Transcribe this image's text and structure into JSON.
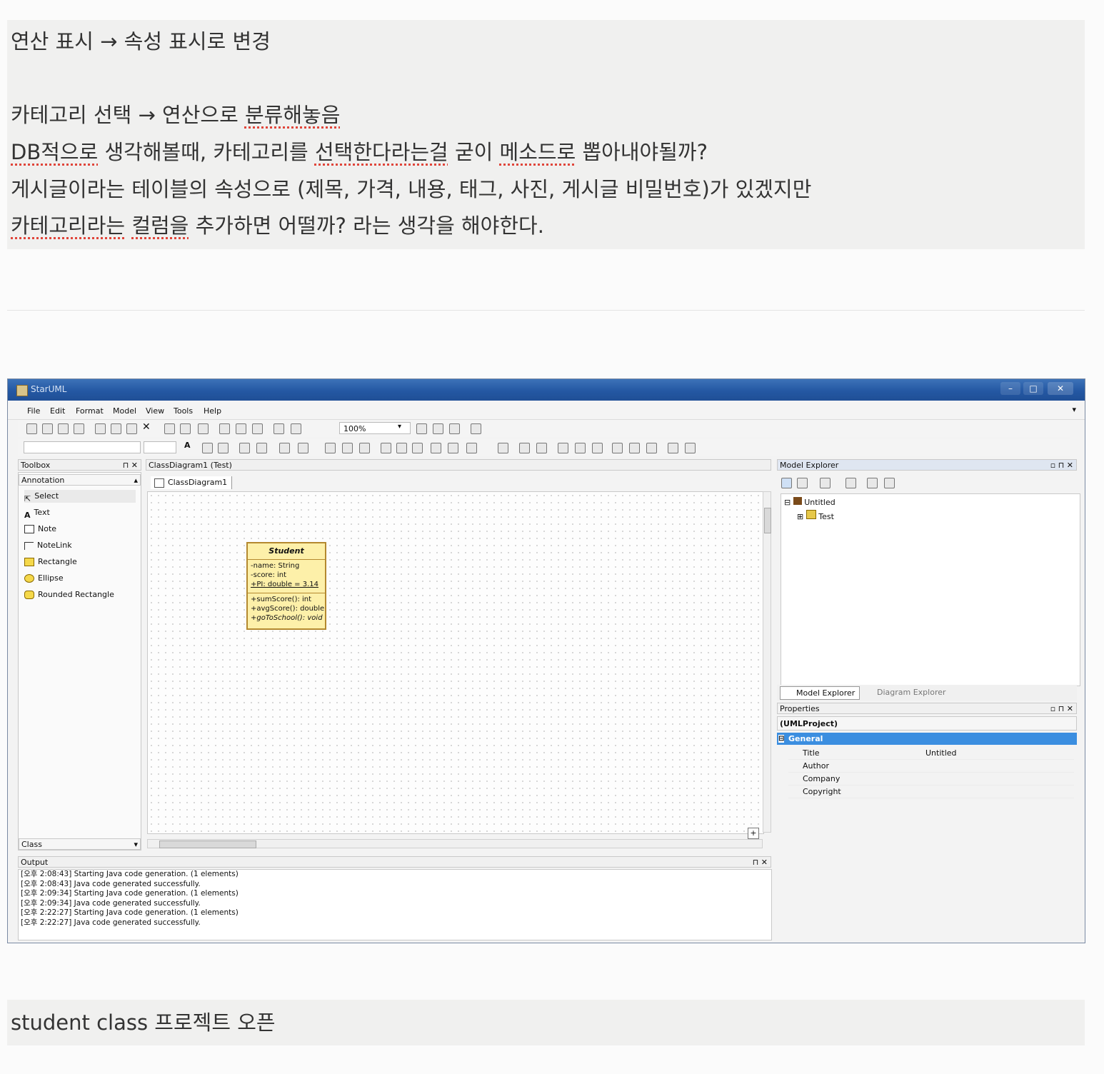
{
  "notes": {
    "top": {
      "line1": "연산 표시 → 속성 표시로 변경",
      "line2_a": "카테고리 선택 → 연산으로 ",
      "line2_b": "분류해놓음",
      "line3_a": "DB적으로",
      "line3_b": " 생각해볼때, 카테고리를 ",
      "line3_c": "선택한다라는걸",
      "line3_d": " 굳이 ",
      "line3_e": "메소드로",
      "line3_f": " 뽑아내야될까?",
      "line4": "게시글이라는 테이블의 속성으로 (제목, 가격, 내용, 태그, 사진, 게시글 비밀번호)가 있겠지만",
      "line5_a": "카테고리라는",
      "line5_b": " ",
      "line5_c": "컬럼을",
      "line5_d": " 추가하면 어떨까? 라는 생각을 해야한다."
    },
    "bottom": "student class 프로젝트 오픈"
  },
  "app": {
    "title": "StarUML",
    "menus": [
      "File",
      "Edit",
      "Format",
      "Model",
      "View",
      "Tools",
      "Help"
    ],
    "zoom": "100%",
    "toolbox": {
      "header": "Toolbox",
      "section": "Annotation",
      "items": [
        "Select",
        "Text",
        "Note",
        "NoteLink",
        "Rectangle",
        "Ellipse",
        "Rounded Rectangle"
      ],
      "footer_section": "Class"
    },
    "diagram": {
      "window_title": "ClassDiagram1 (Test)",
      "tab": "ClassDiagram1",
      "class": {
        "name": "Student",
        "attributes": [
          "-name: String",
          "-score: int",
          "+PI: double = 3.14"
        ],
        "operations": [
          "+sumScore(): int",
          "+avgScore(): double",
          "+goToSchool(): void"
        ]
      }
    },
    "model_explorer": {
      "header": "Model Explorer",
      "root": "Untitled",
      "child": "Test",
      "tabs": [
        "Model Explorer",
        "Diagram Explorer"
      ]
    },
    "properties": {
      "header": "Properties",
      "object": "(UMLProject)",
      "group": "General",
      "rows": [
        {
          "name": "Title",
          "value": "Untitled"
        },
        {
          "name": "Author",
          "value": ""
        },
        {
          "name": "Company",
          "value": ""
        },
        {
          "name": "Copyright",
          "value": ""
        }
      ]
    },
    "output": {
      "header": "Output",
      "lines": [
        "[오후 2:08:43]  Starting Java code generation. (1 elements)",
        "[오후 2:08:43]  Java code generated successfully.",
        "[오후 2:09:34]  Starting Java code generation. (1 elements)",
        "[오후 2:09:34]  Java code generated successfully.",
        "[오후 2:22:27]  Starting Java code generation. (1 elements)",
        "[오후 2:22:27]  Java code generated successfully."
      ]
    },
    "colors": {
      "titlebar": "#2458a3",
      "class_fill": "#fdf0a9",
      "class_border": "#b4892f",
      "selected_group": "#3b8ee0"
    }
  }
}
